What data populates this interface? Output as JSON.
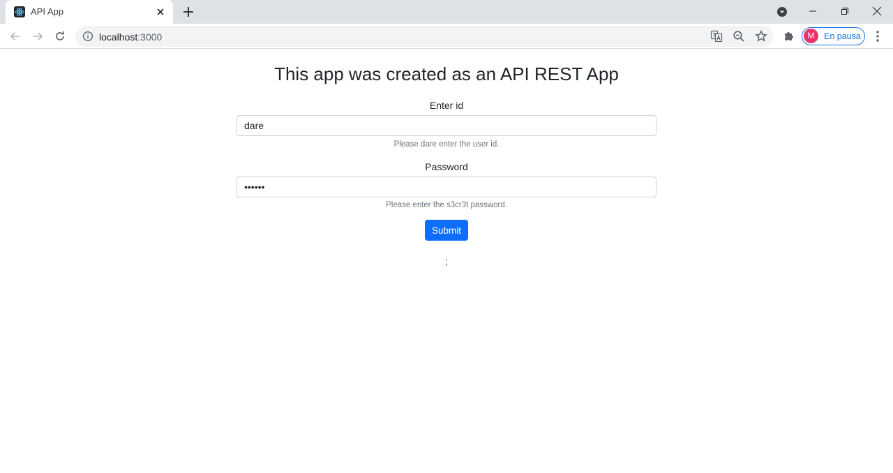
{
  "browser": {
    "tab": {
      "title": "API App"
    },
    "address_bar": {
      "host": "localhost",
      "port": ":3000"
    },
    "profile": {
      "initial": "M",
      "status": "En pausa",
      "avatar_color": "#e8336b",
      "accent_color": "#1a73e8"
    },
    "icons": [
      "react-favicon-icon",
      "tab-close-icon",
      "new-tab-icon",
      "tab-search-icon",
      "minimize-icon",
      "restore-icon",
      "window-close-icon",
      "back-icon",
      "forward-icon",
      "reload-icon",
      "info-icon",
      "translate-icon",
      "zoom-out-icon",
      "bookmark-star-icon",
      "extensions-icon",
      "kebab-menu-icon"
    ]
  },
  "page": {
    "title": "This app was created as an API REST App",
    "id_field": {
      "label": "Enter id",
      "value": "dare",
      "help": "Please dare enter the user id."
    },
    "password_field": {
      "label": "Password",
      "value": "secret",
      "help": "Please enter the s3cr3t password."
    },
    "submit_label": "Submit",
    "result": ";",
    "primary_color": "#0d6efd"
  }
}
